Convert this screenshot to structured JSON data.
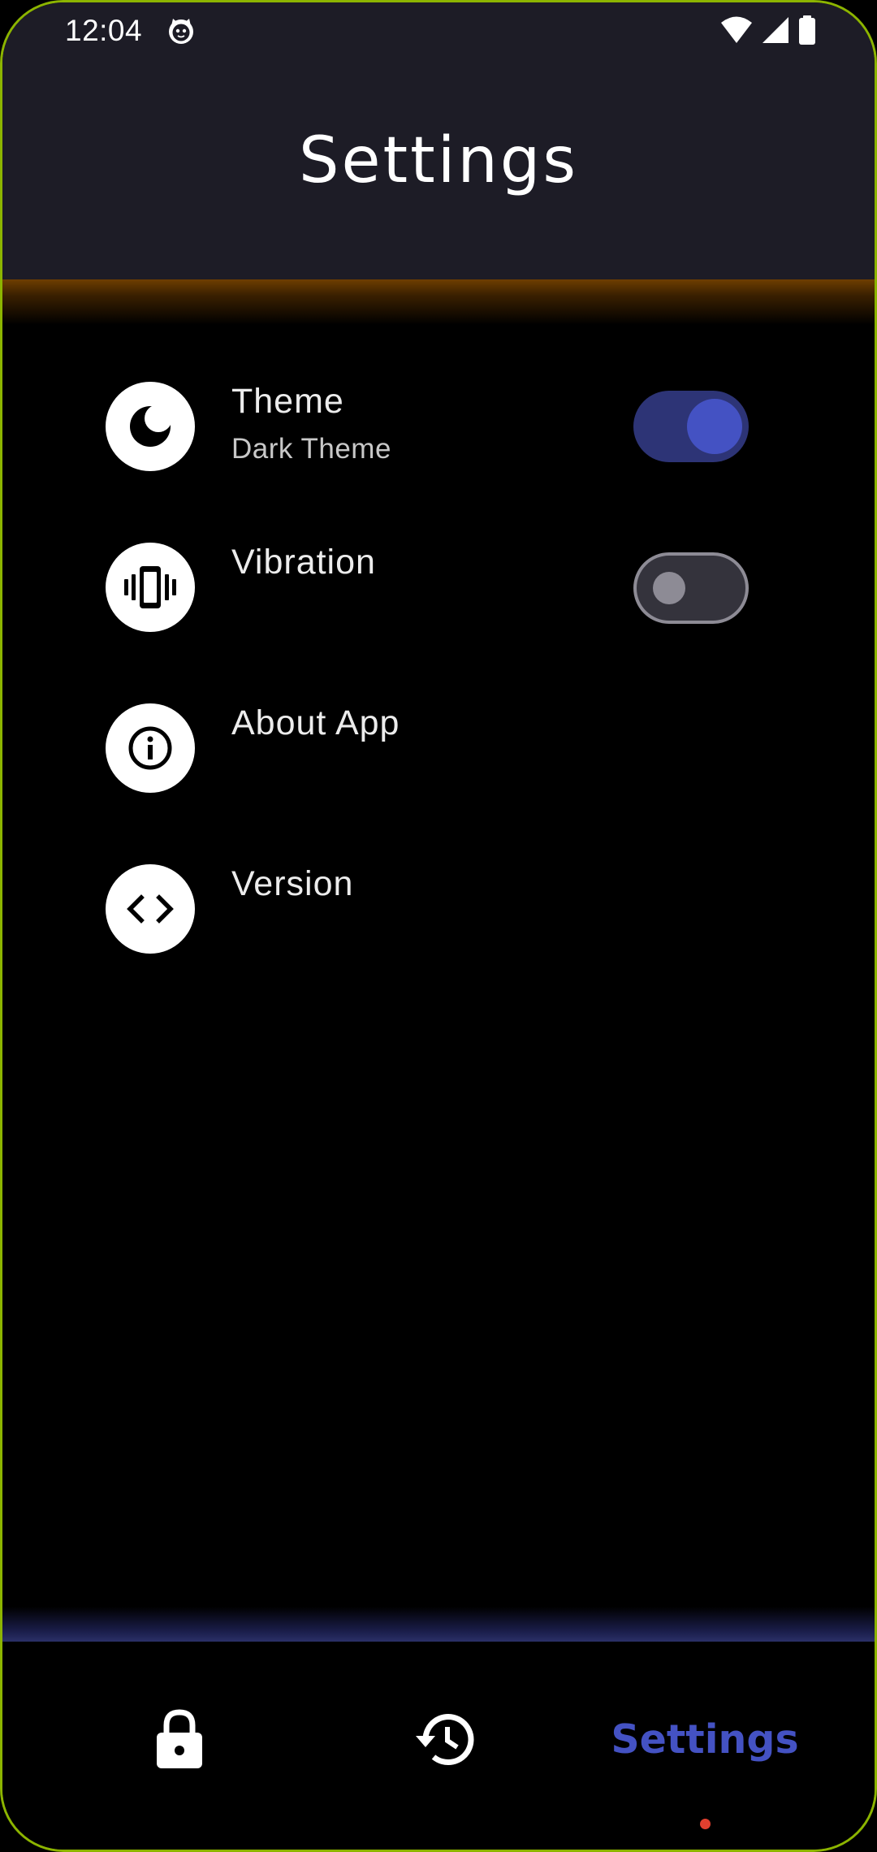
{
  "status_bar": {
    "time": "12:04",
    "app_icon": "cat-face-icon",
    "icons": [
      "wifi-icon",
      "signal-icon",
      "battery-icon"
    ]
  },
  "header": {
    "title": "Settings"
  },
  "settings": [
    {
      "icon": "moon-icon",
      "title": "Theme",
      "subtitle": "Dark Theme",
      "toggle": true,
      "toggle_on": true
    },
    {
      "icon": "vibration-icon",
      "title": "Vibration",
      "toggle": true,
      "toggle_on": false
    },
    {
      "icon": "info-icon",
      "title": "About App"
    },
    {
      "icon": "code-icon",
      "title": "Version"
    }
  ],
  "bottom_nav": {
    "items": [
      {
        "icon": "lock-icon",
        "active": false
      },
      {
        "icon": "history-icon",
        "active": false
      },
      {
        "label": "Settings",
        "active": true
      }
    ]
  },
  "colors": {
    "header_bg": "#1d1c26",
    "accent": "#4452c3",
    "toggle_track_on": "#2d3476",
    "toggle_off": "#8d8b95",
    "header_glow": "#6e3e00",
    "indicator_dot": "#e2402f",
    "frame_border": "#8cb400"
  }
}
